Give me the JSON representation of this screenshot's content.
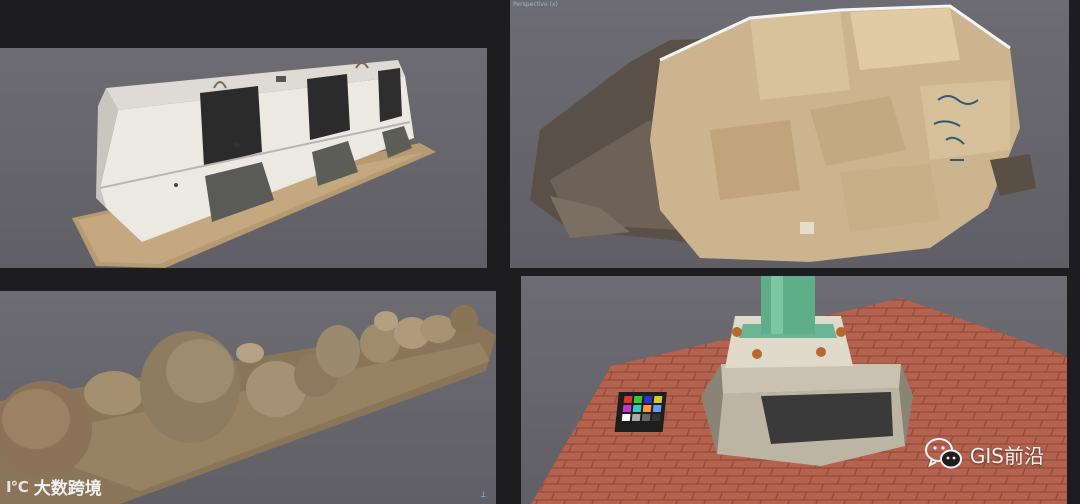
{
  "panels": {
    "top_right": {
      "viewer_label": "Perspective (x)"
    },
    "bottom_left": {
      "axis_indicator": "⊥"
    }
  },
  "watermarks": {
    "left": {
      "logo_text": "Ⅰ℃",
      "text": "大数跨境"
    },
    "right": {
      "icon": "wechat-icon",
      "text": "GIS前沿"
    }
  },
  "colors": {
    "background": "#1d1d1f",
    "viewport": "#66666c",
    "pole": "#5fae8a",
    "tile": "#b5624e"
  }
}
